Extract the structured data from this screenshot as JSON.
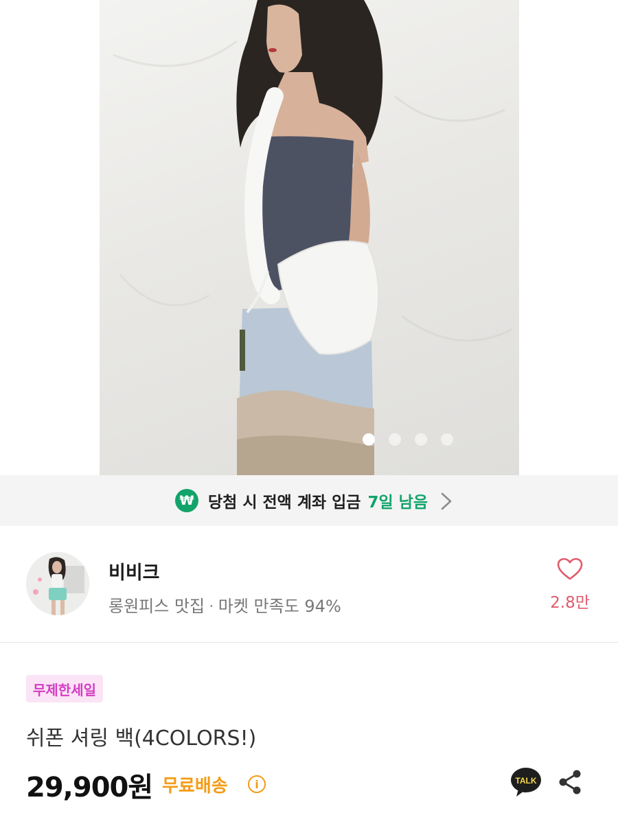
{
  "gallery": {
    "image_count": 4,
    "active_index": 0
  },
  "notice": {
    "icon": "won-icon",
    "icon_text": "₩",
    "message": "당첨 시 전액 계좌 입금",
    "days_left": "7일 남음",
    "accent_color": "#12a36a"
  },
  "seller": {
    "name": "비비크",
    "tagline": "롱원피스 맛집",
    "separator": "·",
    "satisfaction": "마켓 만족도 94%",
    "likes": "2.8만"
  },
  "product": {
    "badge": "무제한세일",
    "title": "쉬폰 셔링 백(4COLORS!)",
    "price": "29,900원",
    "shipping": "무료배송",
    "info_icon_text": "i",
    "talk_label": "TALK"
  },
  "colors": {
    "badge_bg": "#fbe4f6",
    "badge_text": "#d43cc3",
    "shipping": "#f39c16",
    "like": "#e05a6d"
  }
}
